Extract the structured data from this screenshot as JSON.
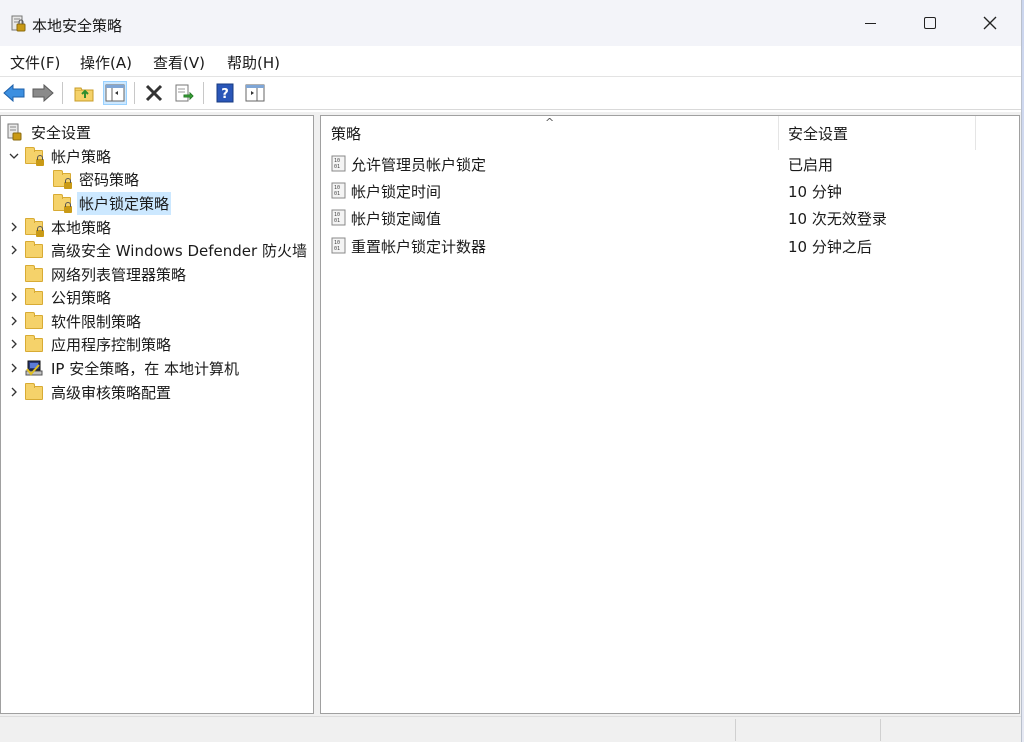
{
  "window": {
    "title": "本地安全策略"
  },
  "menu": [
    "文件(F)",
    "操作(A)",
    "查看(V)",
    "帮助(H)"
  ],
  "toolbar": {
    "buttons": [
      "back-icon",
      "forward-icon",
      "up-folder-icon",
      "show-hide-tree-icon",
      "delete-icon",
      "export-list-icon",
      "help-icon",
      "properties-icon"
    ],
    "active": "show-hide-tree-icon"
  },
  "tree": {
    "root": "安全设置",
    "items": [
      {
        "label": "帐户策略",
        "level": 1,
        "expander": "open",
        "icon": "folder-lock"
      },
      {
        "label": "密码策略",
        "level": 2,
        "expander": "none",
        "icon": "folder-lock"
      },
      {
        "label": "帐户锁定策略",
        "level": 2,
        "expander": "none",
        "icon": "folder-lock",
        "selected": true
      },
      {
        "label": "本地策略",
        "level": 1,
        "expander": "closed",
        "icon": "folder-lock"
      },
      {
        "label": "高级安全 Windows Defender 防火墙",
        "level": 1,
        "expander": "closed",
        "icon": "folder"
      },
      {
        "label": "网络列表管理器策略",
        "level": 1,
        "expander": "none",
        "icon": "folder"
      },
      {
        "label": "公钥策略",
        "level": 1,
        "expander": "closed",
        "icon": "folder"
      },
      {
        "label": "软件限制策略",
        "level": 1,
        "expander": "closed",
        "icon": "folder"
      },
      {
        "label": "应用程序控制策略",
        "level": 1,
        "expander": "closed",
        "icon": "folder"
      },
      {
        "label": "IP 安全策略，在 本地计算机",
        "level": 1,
        "expander": "closed",
        "icon": "ip-security"
      },
      {
        "label": "高级审核策略配置",
        "level": 1,
        "expander": "closed",
        "icon": "folder"
      }
    ]
  },
  "list": {
    "columns": [
      "策略",
      "安全设置"
    ],
    "sort_indicator": "^",
    "rows": [
      {
        "policy": "允许管理员帐户锁定",
        "setting": "已启用"
      },
      {
        "policy": "帐户锁定时间",
        "setting": "10 分钟"
      },
      {
        "policy": "帐户锁定阈值",
        "setting": "10 次无效登录"
      },
      {
        "policy": "重置帐户锁定计数器",
        "setting": "10 分钟之后"
      }
    ]
  },
  "colors": {
    "selection": "#cce8ff",
    "folder": "#f5d26a"
  }
}
